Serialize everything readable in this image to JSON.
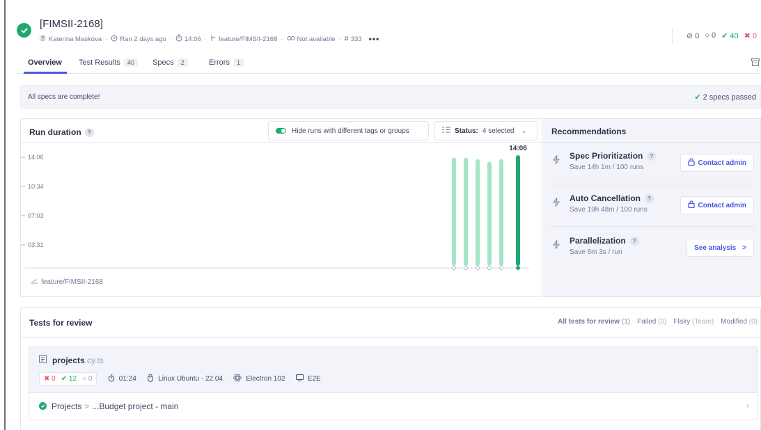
{
  "run": {
    "title": "[FIMSII-2168]",
    "author": "Katerina Maskova",
    "ran": "Ran 2 days ago",
    "duration": "14:06",
    "branch": "feature/FIMSII-2168",
    "commit": "Not available",
    "number": "333",
    "more": "•••"
  },
  "counts": {
    "skipped": "0",
    "pending": "0",
    "passed": "40",
    "failed": "0"
  },
  "tabs": [
    {
      "label": "Overview",
      "badge": ""
    },
    {
      "label": "Test Results",
      "badge": "40"
    },
    {
      "label": "Specs",
      "badge": "2"
    },
    {
      "label": "Errors",
      "badge": "1"
    }
  ],
  "banner": {
    "text": "All specs are complete!",
    "right": "2 specs passed"
  },
  "duration_card": {
    "title": "Run duration",
    "help": "?",
    "toggle_label": "Hide runs with different tags or groups",
    "status_label": "Status:",
    "status_value": "4 selected",
    "branch": "feature/FIMSII-2168"
  },
  "chart_data": {
    "type": "bar",
    "ylabel": "",
    "yticks": [
      "14:06",
      "10:34",
      "07:03",
      "03:31"
    ],
    "ylim_seconds": [
      0,
      960
    ],
    "series": [
      {
        "values_seconds": [
          827,
          827,
          815,
          795,
          815,
          846
        ],
        "colors": [
          "#a3e6c5",
          "#a3e6c5",
          "#a3e6c5",
          "#a3e6c5",
          "#a3e6c5",
          "#1fa971"
        ]
      }
    ],
    "highlight_label": "14:06"
  },
  "recommendations": {
    "title": "Recommendations",
    "items": [
      {
        "title": "Spec Prioritization",
        "subtitle": "Save 14h 1m / 100 runs",
        "button": "Contact admin",
        "button_icon": "lock-icon"
      },
      {
        "title": "Auto Cancellation",
        "subtitle": "Save 19h 48m / 100 runs",
        "button": "Contact admin",
        "button_icon": "lock-icon"
      },
      {
        "title": "Parallelization",
        "subtitle": "Save 6m 3s / run",
        "button": "See analysis",
        "button_icon": "chevron-right-icon"
      }
    ]
  },
  "tests_for_review": {
    "title": "Tests for review",
    "filters": [
      {
        "label": "All tests for review",
        "count": "(1)"
      },
      {
        "label": "Failed",
        "count": "(0)"
      },
      {
        "label": "Flaky",
        "count": "(Team)"
      },
      {
        "label": "Modified",
        "count": "(0)"
      }
    ],
    "spec": {
      "name": "projects",
      "ext": ".cy.ts",
      "failed": "0",
      "passed": "12",
      "pending": "0",
      "duration": "01:24",
      "os": "Linux Ubuntu - 22.04",
      "browser": "Electron 102",
      "testing_type": "E2E",
      "path_a": "Projects",
      "path_b": "...Budget project - main"
    }
  },
  "colors": {
    "accent": "#4956e3",
    "pass": "#1fa971",
    "fail": "#e45770",
    "bar_light": "#a3e6c5"
  }
}
